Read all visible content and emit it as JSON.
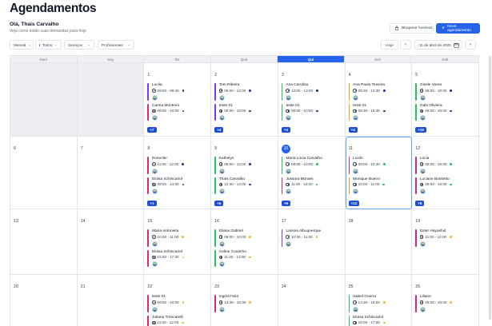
{
  "header": {
    "title": "Agendamentos",
    "greeting": "Olá, Thais Carvalho",
    "subgreeting": "Veja como estão suas demandas para hoje",
    "block_label": "Bloquear horários",
    "new_label": "Novo agendamento"
  },
  "filters": {
    "view": "Mensal",
    "status": "Todos",
    "services": "Serviços",
    "professionals": "Profissionais"
  },
  "nav": {
    "today_label": "Hoje",
    "prev": "‹",
    "next": "›",
    "date": "11 de abril de 2025"
  },
  "colors": {
    "accent": "#2563eb",
    "status_blue": "#1e3a8a",
    "status_green": "#22c55e",
    "status_yellow": "#f5b82e",
    "bar_pink": "#db2777",
    "bar_orange": "#f59e0b",
    "bar_green": "#22c55e",
    "bar_purple": "#7c3aed",
    "bar_blue": "#3b82f6"
  },
  "weekdays": [
    "Dom",
    "Seg",
    "Ter",
    "Qua",
    "Qui",
    "Sex",
    "Sab"
  ],
  "active_weekday": 4,
  "days": [
    {
      "num": "",
      "muted": true,
      "appts": []
    },
    {
      "num": "",
      "muted": true,
      "appts": []
    },
    {
      "num": "1",
      "appts": [
        {
          "name": "Lucila",
          "time": "09:00 - 09:40",
          "bar": "bar_purple",
          "dot": "status_blue"
        },
        {
          "name": "Carina Monteiro",
          "time": "09:00 - 10:00",
          "bar": "bar_pink",
          "dot": "status_blue"
        }
      ],
      "more": "+7"
    },
    {
      "num": "2",
      "appts": [
        {
          "name": "Tom Ribeira",
          "time": "09:00 - 12:00",
          "bar": "bar_purple",
          "dot": "status_blue"
        },
        {
          "name": "teste 01",
          "time": "09:00 - 10:00",
          "bar": "bar_purple",
          "dot": "status_blue"
        }
      ],
      "more": "+4"
    },
    {
      "num": "3",
      "appts": [
        {
          "name": "Ana Carolina",
          "time": "12:00 - 13:00",
          "bar": "bar_green",
          "dot": "status_blue"
        },
        {
          "name": "teste 01",
          "time": "09:00 - 10:00",
          "bar": "bar_green",
          "dot": "status_blue"
        }
      ],
      "more": "+4"
    },
    {
      "num": "4",
      "appts": [
        {
          "name": "Ana Paula Teixeira",
          "time": "09:30 - 10:30",
          "bar": "bar_orange",
          "dot": "status_blue"
        },
        {
          "name": "teste 01",
          "time": "09:30 - 15:45",
          "bar": "bar_orange",
          "dot": "status_blue"
        }
      ],
      "more": "+4"
    },
    {
      "num": "5",
      "appts": [
        {
          "name": "Gisele Vieira",
          "time": "09:00 - 10:00",
          "bar": "bar_green",
          "dot": "status_blue"
        },
        {
          "name": "Gabi Oliveira",
          "time": "09:00 - 10:00",
          "bar": "bar_green",
          "dot": "status_blue"
        }
      ],
      "more": "+15"
    },
    {
      "num": "6",
      "appts": []
    },
    {
      "num": "7",
      "appts": []
    },
    {
      "num": "8",
      "appts": [
        {
          "name": "Rosecler",
          "time": "11:00 - 12:00",
          "bar": "bar_pink",
          "dot": "status_blue"
        },
        {
          "name": "Eloisa Schincariol",
          "time": "09:00 - 14:00",
          "bar": "bar_pink",
          "dot": "status_blue"
        }
      ],
      "more": "+1"
    },
    {
      "num": "9",
      "appts": [
        {
          "name": "Kathelyn",
          "time": "09:00 - 12:00",
          "bar": "bar_green",
          "dot": "status_blue"
        },
        {
          "name": "Thais Carvalho",
          "time": "12:30 - 14:00",
          "bar": "bar_green",
          "dot": "status_blue"
        }
      ],
      "more": "+5"
    },
    {
      "num": "10",
      "today": true,
      "appts": [
        {
          "name": "Maria Lúcia Carvalho",
          "time": "09:00 - 10:00",
          "bar": "bar_green",
          "dot": "status_green"
        },
        {
          "name": "Jussara Moraes",
          "time": "11:00 - 12:00",
          "bar": "bar_pink",
          "dot": "status_green"
        }
      ],
      "more": "+6"
    },
    {
      "num": "11",
      "selected": true,
      "appts": [
        {
          "name": "Lucilo",
          "time": "09:00 - 10:30",
          "bar": "bar_pink",
          "dot": "status_green"
        },
        {
          "name": "Monique Bueno",
          "time": "10:00 - 11:00",
          "bar": "bar_orange",
          "dot": "status_green"
        }
      ],
      "more": "+12"
    },
    {
      "num": "12",
      "appts": [
        {
          "name": "Lúcia",
          "time": "09:00 - 10:00",
          "bar": "bar_pink",
          "dot": "status_green"
        },
        {
          "name": "Luciane Bossetto",
          "time": "09:00 - 10:00",
          "bar": "bar_pink",
          "dot": "status_green"
        }
      ],
      "more": "+8"
    },
    {
      "num": "13",
      "appts": []
    },
    {
      "num": "14",
      "appts": []
    },
    {
      "num": "15",
      "appts": [
        {
          "name": "Maria Antonieta",
          "time": "10:00 - 11:00",
          "bar": "bar_pink",
          "dot": "status_yellow"
        },
        {
          "name": "Eloisa Schincariol",
          "time": "15:30 - 17:30",
          "bar": "bar_pink",
          "dot": "status_yellow"
        }
      ]
    },
    {
      "num": "16",
      "appts": [
        {
          "name": "Eliana Gabriel",
          "time": "09:00 - 10:00",
          "bar": "bar_green",
          "dot": "status_yellow"
        },
        {
          "name": "Celine Coutinho",
          "time": "11:30 - 13:00",
          "bar": "bar_green",
          "dot": "status_yellow"
        }
      ]
    },
    {
      "num": "17",
      "appts": [
        {
          "name": "Larissa Albuquerque",
          "time": "10:30 - 11:30",
          "bar": "bar_purple",
          "dot": "status_yellow"
        }
      ]
    },
    {
      "num": "18",
      "appts": []
    },
    {
      "num": "19",
      "appts": [
        {
          "name": "Ester Hayashid",
          "time": "11:00 - 12:00",
          "bar": "bar_pink",
          "dot": "status_yellow"
        }
      ]
    },
    {
      "num": "20",
      "appts": []
    },
    {
      "num": "21",
      "appts": []
    },
    {
      "num": "22",
      "appts": [
        {
          "name": "teste 01",
          "time": "09:00 - 10:00",
          "bar": "bar_pink",
          "dot": "status_yellow"
        },
        {
          "name": "Juliana Troncarelli",
          "time": "11:00 - 12:00",
          "bar": "bar_pink",
          "dot": "status_yellow"
        }
      ]
    },
    {
      "num": "23",
      "appts": [
        {
          "name": "Ingrid Faria",
          "time": "14:30 - 15:30",
          "bar": "bar_pink",
          "dot": "status_yellow"
        }
      ]
    },
    {
      "num": "24",
      "appts": []
    },
    {
      "num": "25",
      "appts": [
        {
          "name": "Isabel Guerra",
          "time": "14:30 - 16:00",
          "bar": "bar_green",
          "dot": "status_yellow"
        },
        {
          "name": "Eloisa Schincariol",
          "time": "16:00 - 17:00",
          "bar": "bar_green",
          "dot": "status_yellow"
        }
      ]
    },
    {
      "num": "26",
      "appts": [
        {
          "name": "Liliane",
          "time": "09:00 - 10:00",
          "bar": "bar_pink",
          "dot": "status_yellow"
        }
      ]
    }
  ]
}
